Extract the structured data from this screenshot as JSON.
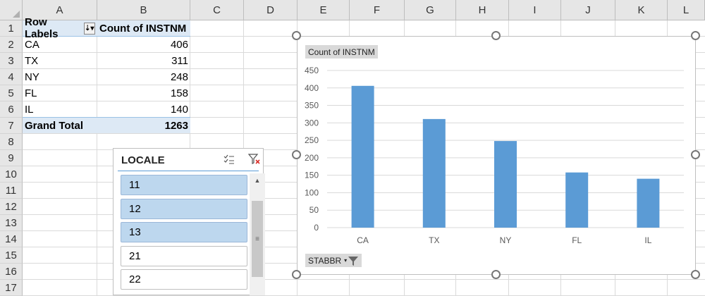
{
  "columns": [
    "A",
    "B",
    "C",
    "D",
    "E",
    "F",
    "G",
    "H",
    "I",
    "J",
    "K",
    "L"
  ],
  "rows": [
    "1",
    "2",
    "3",
    "4",
    "5",
    "6",
    "7",
    "8",
    "9",
    "10",
    "11",
    "12",
    "13",
    "14",
    "15",
    "16",
    "17"
  ],
  "pivot": {
    "row_labels_header": "Row Labels",
    "value_header": "Count of INSTNM",
    "rows": [
      {
        "label": "CA",
        "value": "406"
      },
      {
        "label": "TX",
        "value": "311"
      },
      {
        "label": "NY",
        "value": "248"
      },
      {
        "label": "FL",
        "value": "158"
      },
      {
        "label": "IL",
        "value": "140"
      }
    ],
    "grand_total_label": "Grand Total",
    "grand_total_value": "1263"
  },
  "slicer": {
    "title": "LOCALE",
    "items": [
      {
        "label": "11",
        "selected": true
      },
      {
        "label": "12",
        "selected": true
      },
      {
        "label": "13",
        "selected": true
      },
      {
        "label": "21",
        "selected": false
      },
      {
        "label": "22",
        "selected": false
      }
    ]
  },
  "chart_data": {
    "type": "bar",
    "title": "",
    "value_field_button": "Count of INSTNM",
    "axis_field_button": "STABBR",
    "categories": [
      "CA",
      "TX",
      "NY",
      "FL",
      "IL"
    ],
    "series": [
      {
        "values": [
          406,
          311,
          248,
          158,
          140
        ]
      }
    ],
    "ylim": [
      0,
      450
    ],
    "yticks": [
      "0",
      "50",
      "100",
      "150",
      "200",
      "250",
      "300",
      "350",
      "400",
      "450"
    ],
    "grid": true,
    "bar_color": "#5b9bd5"
  }
}
